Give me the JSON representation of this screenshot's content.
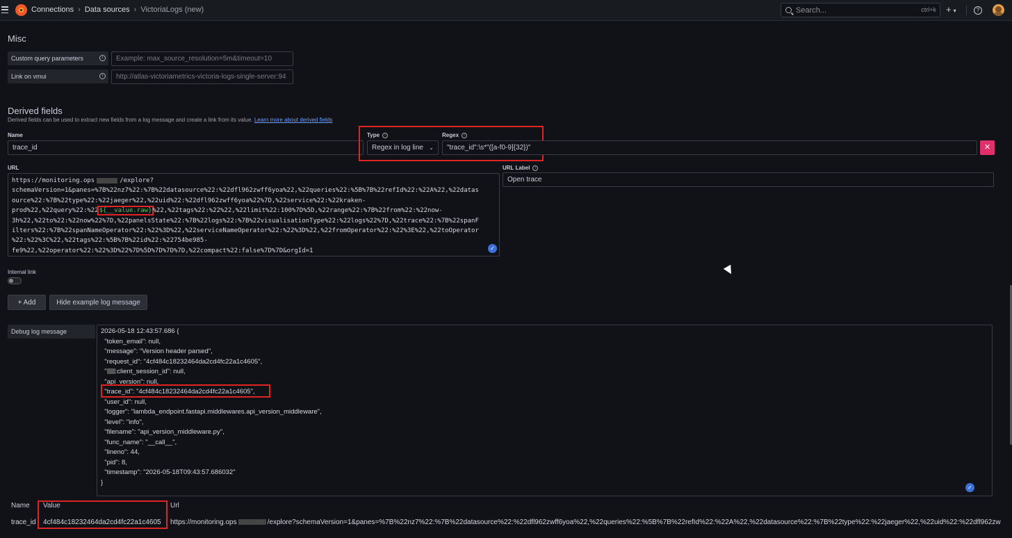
{
  "topbar": {
    "breadcrumbs": [
      "Connections",
      "Data sources",
      "VictoriaLogs (new)"
    ],
    "separator": "›",
    "search_placeholder": "Search...",
    "search_shortcut": "ctrl+k",
    "plus_label": "+",
    "help_label": "?"
  },
  "misc": {
    "title": "Misc",
    "custom_query_label": "Custom query parameters",
    "custom_query_placeholder": "Example: max_source_resolution=5m&timeout=10",
    "link_vmui_label": "Link on vmui",
    "link_vmui_placeholder": "http://atlas-victoriametrics-victoria-logs-single-server:94"
  },
  "derived": {
    "title": "Derived fields",
    "description": "Derived fields can be used to extract new fields from a log message and create a link from its value.",
    "learn_more": "Learn more about derived fields",
    "name_label": "Name",
    "name_value": "trace_id",
    "type_label": "Type",
    "type_value": "Regex in log line",
    "regex_label": "Regex",
    "regex_value": "\"trace_id\":\\s*\"([a-f0-9]{32})\"",
    "delete_label": "✕",
    "url_label": "URL",
    "url_label_label": "URL Label",
    "url_label_value": "Open trace",
    "url_lines": [
      "https://monitoring.ops",
      "/explore?",
      "schemaVersion=1&panes=%7B%22nz7%22:%7B%22datasource%22:%22dfl962zwff6yoa%22,%22queries%22:%5B%7B%22refId%22:%22A%22,%22datas",
      "ource%22:%7B%22type%22:%22jaeger%22,%22uid%22:%22dfl962zwff6yoa%22%7D,%22service%22:%22kraken-",
      "prod%22,%22query%22:%22",
      "${__value.raw}",
      "%22,%22tags%22:%22%22,%22limit%22:100%7D%5D,%22range%22:%7B%22from%22:%22now-",
      "3h%22,%22to%22:%22now%22%7D,%22panelsState%22:%7B%22logs%22:%7B%22visualisationType%22:%22logs%22%7D,%22trace%22:%7B%22spanF",
      "ilters%22:%7B%22spanNameOperator%22:%22%3D%22,%22serviceNameOperator%22:%22%3D%22,%22fromOperator%22:%22%3E%22,%22toOperator",
      "%22:%22%3C%22,%22tags%22:%5B%7B%22id%22:%22754be985-",
      "fe9%22,%22operator%22:%22%3D%22%7D%5D%7D%7D%7D,%22compact%22:false%7D%7D&orgId=1"
    ],
    "internal_link_label": "Internal link",
    "add_label": "+ Add",
    "hide_example_label": "Hide example log message",
    "debug_label": "Debug log message",
    "debug_lines": [
      "2026-05-18 12:43:57.686 {",
      "  \"token_email\": null,",
      "  \"message\": \"Version header parsed\",",
      "  \"request_id\": \"4cf484c18232464da2cd4fc22a1c4605\",",
      "  \"",
      ":client_session_id\": null,",
      "  \"api_version\": null,",
      "\"trace_id\": \"4cf484c18232464da2cd4fc22a1c4605\",",
      "  \"user_id\": null,",
      "  \"logger\": \"lambda_endpoint.fastapi.middlewares.api_version_middleware\",",
      "  \"level\": \"info\",",
      "  \"filename\": \"api_version_middleware.py\",",
      "  \"func_name\": \"__call__\",",
      "  \"lineno\": 44,",
      "  \"pid\": 8,",
      "  \"timestamp\": \"2026-05-18T09:43:57.686032\"",
      "}"
    ],
    "result_headers": [
      "Name",
      "Value",
      "Url"
    ],
    "result_name": "trace_id",
    "result_value": "4cf484c18232464da2cd4fc22a1c4605",
    "result_url_prefix": "https://monitoring.ops",
    "result_url_suffix": "/explore?schemaVersion=1&panes=%7B%22nz7%22:%7B%22datasource%22:%22dfl962zwff6yoa%22,%22queries%22:%5B%7B%22refId%22:%22A%22,%22datasource%22:%7B%22type%22:%22jaeger%22,%22uid%22:%22dfl962zw"
  },
  "colors": {
    "highlight": "#e02424",
    "accent": "#3d71d9",
    "danger": "#e02f6a",
    "var_green": "#56c25e"
  }
}
